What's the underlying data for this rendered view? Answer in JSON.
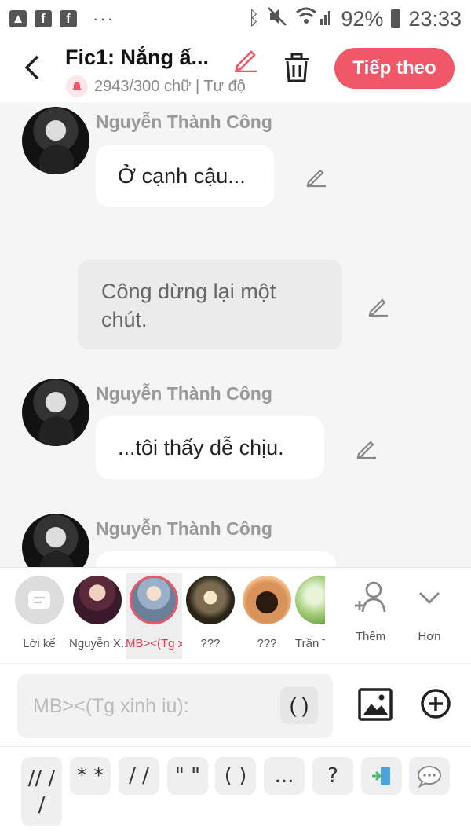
{
  "status_bar": {
    "battery": "92%",
    "time": "23:33",
    "dots": "···"
  },
  "header": {
    "title": "Fic1: Nắng ấ...",
    "subtitle": "2943/300 chữ | Tự độ",
    "next_label": "Tiếp theo",
    "back_glyph": "<"
  },
  "chat": {
    "messages": [
      {
        "name": "Nguyễn Thành Công",
        "text": "Ở cạnh cậu..."
      },
      {
        "narration": "Công dừng lại một chút."
      },
      {
        "name": "Nguyễn Thành Công",
        "text": "...tôi thấy dễ chịu."
      },
      {
        "name": "Nguyễn Thành Công",
        "text": ""
      }
    ]
  },
  "characters": [
    {
      "label": "Lời kể"
    },
    {
      "label": "Nguyễn X..."
    },
    {
      "label": "MB><(Tg x..."
    },
    {
      "label": "???"
    },
    {
      "label": "???"
    },
    {
      "label": "Trần T..."
    }
  ],
  "controls": {
    "more_label": "Thêm",
    "less_label": "Hơn"
  },
  "input": {
    "placeholder": "MB><(Tg xinh iu):",
    "paren_button": "( )"
  },
  "shortcut_keys": [
    "// /\n/",
    "* *",
    "/ /",
    "\" \"",
    "( )",
    "...",
    "?"
  ],
  "colors": {
    "accent": "#f25767",
    "selected_border": "#e45a6a"
  }
}
